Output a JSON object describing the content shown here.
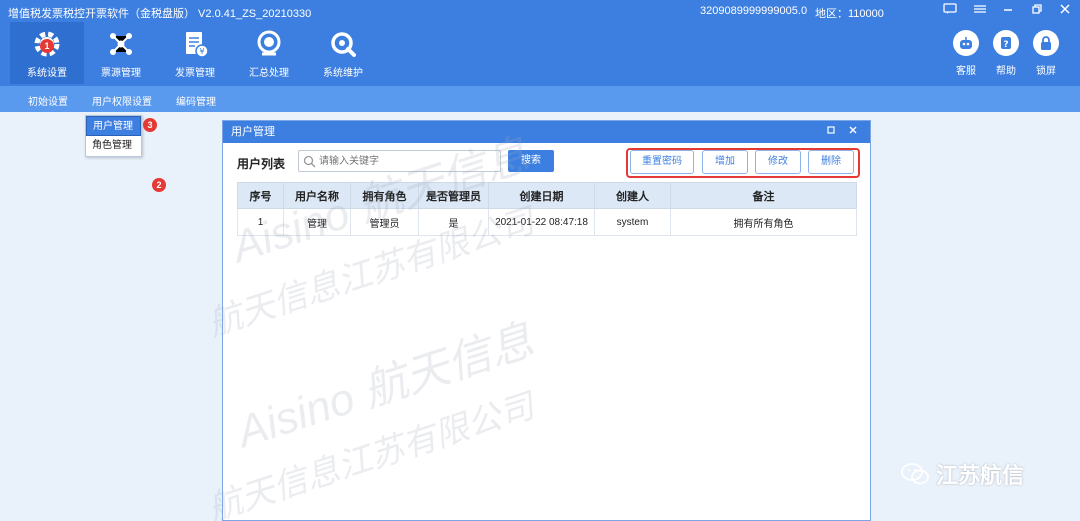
{
  "header": {
    "app_title": "增值税发票税控开票软件（金税盘版） V2.0.41_ZS_20210330",
    "tax_id": "3209089999999005.0",
    "region": "地区：110000"
  },
  "nav": [
    {
      "label": "系统设置",
      "icon": "gear-icon",
      "badge": "1"
    },
    {
      "label": "票源管理",
      "icon": "network-icon"
    },
    {
      "label": "发票管理",
      "icon": "invoice-icon"
    },
    {
      "label": "汇总处理",
      "icon": "summary-icon"
    },
    {
      "label": "系统维护",
      "icon": "wrench-icon"
    }
  ],
  "right_buttons": [
    {
      "label": "客服",
      "icon": "robot-icon"
    },
    {
      "label": "帮助",
      "icon": "help-icon"
    },
    {
      "label": "锁屏",
      "icon": "lock-icon"
    }
  ],
  "subnav": [
    {
      "label": "初始设置"
    },
    {
      "label": "用户权限设置",
      "badge": "2"
    },
    {
      "label": "编码管理"
    }
  ],
  "dropdown": {
    "items": [
      {
        "label": "用户管理",
        "badge": "3"
      },
      {
        "label": "角色管理"
      }
    ]
  },
  "window": {
    "title": "用户管理",
    "list_title": "用户列表",
    "search_placeholder": "请输入关键字",
    "search_label": "搜索",
    "actions": {
      "reset": "重置密码",
      "add": "增加",
      "edit": "修改",
      "delete": "删除"
    },
    "table": {
      "headers": [
        "序号",
        "用户名称",
        "拥有角色",
        "是否管理员",
        "创建日期",
        "创建人",
        "备注"
      ],
      "rows": [
        [
          "1",
          "管理",
          "管理员",
          "是",
          "2021-01-22 08:47:18",
          "system",
          "拥有所有角色"
        ]
      ]
    }
  },
  "watermark": {
    "line1": "Aisino 航天信息",
    "line2": "航天信息江苏有限公司"
  },
  "brand": "江苏航信"
}
